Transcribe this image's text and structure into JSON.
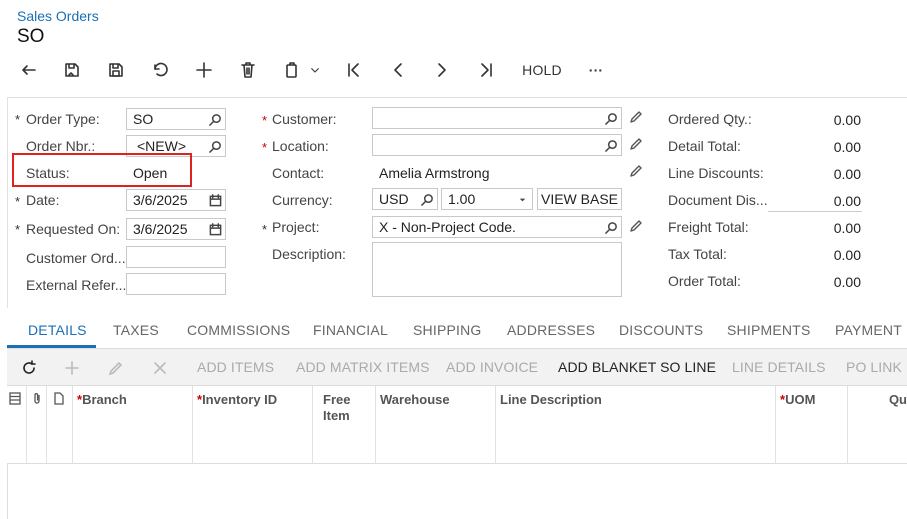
{
  "header": {
    "breadcrumb": "Sales Orders",
    "title": "SO"
  },
  "toolbar": {
    "hold_label": "HOLD",
    "more_label": "···"
  },
  "form": {
    "order_type_label": "Order Type:",
    "order_type_value": "SO",
    "order_nbr_label": "Order Nbr.:",
    "order_nbr_value": "<NEW>",
    "status_label": "Status:",
    "status_value": "Open",
    "date_label": "Date:",
    "date_value": "3/6/2025",
    "requested_on_label": "Requested On:",
    "requested_on_value": "3/6/2025",
    "customer_ord_label": "Customer Ord...",
    "customer_ord_value": "",
    "external_ref_label": "External Refer...",
    "external_ref_value": "",
    "customer_label": "Customer:",
    "customer_value": "",
    "location_label": "Location:",
    "location_value": "",
    "contact_label": "Contact:",
    "contact_value": "Amelia Armstrong",
    "currency_label": "Currency:",
    "currency_value": "USD",
    "rate_value": "1.00",
    "view_base_label": "VIEW BASE",
    "project_label": "Project:",
    "project_value": "X - Non-Project Code.",
    "description_label": "Description:",
    "description_value": ""
  },
  "totals": [
    {
      "label": "Ordered Qty.:",
      "value": "0.00"
    },
    {
      "label": "Detail Total:",
      "value": "0.00"
    },
    {
      "label": "Line Discounts:",
      "value": "0.00"
    },
    {
      "label": "Document Dis...",
      "value": "0.00"
    },
    {
      "label": "Freight Total:",
      "value": "0.00"
    },
    {
      "label": "Tax Total:",
      "value": "0.00"
    },
    {
      "label": "Order Total:",
      "value": "0.00"
    }
  ],
  "tabs": [
    "DETAILS",
    "TAXES",
    "COMMISSIONS",
    "FINANCIAL",
    "SHIPPING",
    "ADDRESSES",
    "DISCOUNTS",
    "SHIPMENTS",
    "PAYMENT L"
  ],
  "grid_toolbar": {
    "add_items": "ADD ITEMS",
    "add_matrix_items": "ADD MATRIX ITEMS",
    "add_invoice": "ADD INVOICE",
    "add_blanket_so_line": "ADD BLANKET SO LINE",
    "line_details": "LINE DETAILS",
    "po_link": "PO LINK"
  },
  "grid_columns": {
    "branch": "Branch",
    "inventory_id": "Inventory ID",
    "free_item_1": "Free",
    "free_item_2": "Item",
    "warehouse": "Warehouse",
    "line_description": "Line Description",
    "uom": "UOM",
    "qty": "Qu"
  },
  "colors": {
    "accent": "#1a6fb5",
    "required": "#cc0000",
    "highlight_box": "#dd2222"
  }
}
